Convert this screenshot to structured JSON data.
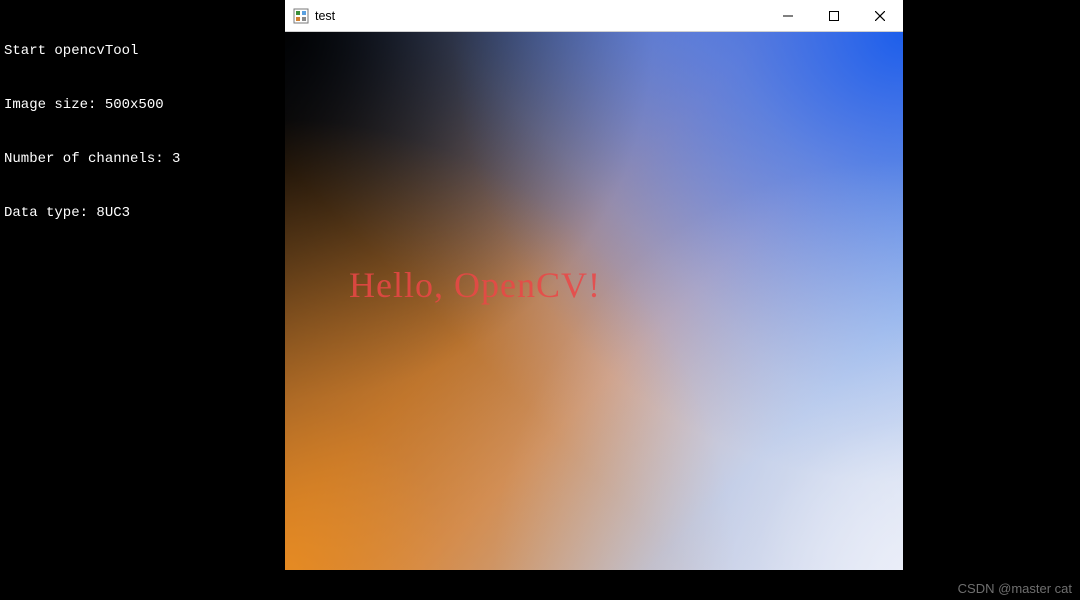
{
  "console": {
    "lines": [
      "Start opencvTool",
      "Image size: 500x500",
      "Number of channels: 3",
      "Data type: 8UC3"
    ]
  },
  "window": {
    "title": "test",
    "icon_name": "app-icon",
    "buttons": {
      "minimize_label": "Minimize",
      "maximize_label": "Maximize",
      "close_label": "Close"
    },
    "content": {
      "overlay_text": "Hello, OpenCV!",
      "overlay_color": "#eb4646",
      "gradient_corners": {
        "top_left": "#000000",
        "top_right": "#145aeb",
        "bottom_left": "#eb8c1e",
        "bottom_right": "#ebeef8"
      }
    }
  },
  "watermark": "CSDN @master cat"
}
